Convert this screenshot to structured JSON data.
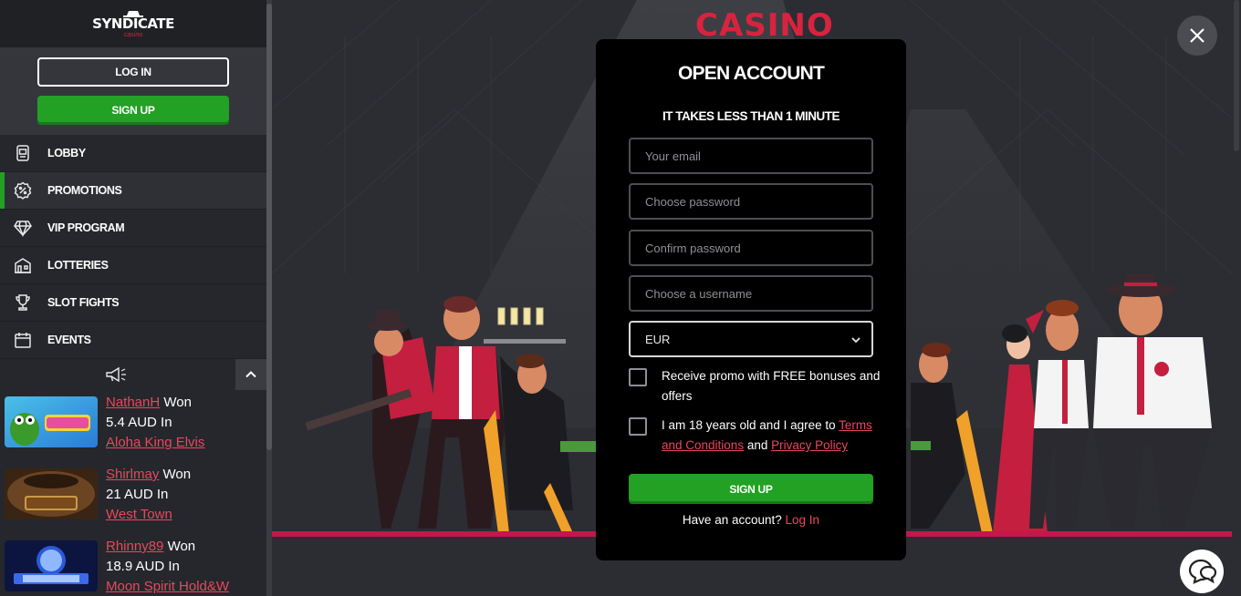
{
  "brand": {
    "logo_main": "SYNDICATE",
    "logo_sub": "casino",
    "casino_banner": "CASINO"
  },
  "sidebar": {
    "login_label": "LOG IN",
    "signup_label": "SIGN UP",
    "items": [
      {
        "label": "LOBBY",
        "icon": "slot-machine-icon"
      },
      {
        "label": "PROMOTIONS",
        "icon": "percent-badge-icon"
      },
      {
        "label": "VIP PROGRAM",
        "icon": "diamond-icon"
      },
      {
        "label": "LOTTERIES",
        "icon": "building-icon"
      },
      {
        "label": "SLOT FIGHTS",
        "icon": "trophy-icon"
      },
      {
        "label": "EVENTS",
        "icon": "calendar-icon"
      }
    ],
    "winners": [
      {
        "player": "NathanH",
        "won_word": "Won",
        "amount": "5.4 AUD In",
        "game": "Aloha King Elvis"
      },
      {
        "player": "Shirlmay",
        "won_word": "Won",
        "amount": "21 AUD In",
        "game": "West Town"
      },
      {
        "player": "Rhinny89",
        "won_word": "Won",
        "amount": "18.9 AUD In",
        "game": "Moon Spirit Hold&W"
      }
    ]
  },
  "modal": {
    "title": "OPEN ACCOUNT",
    "subtitle": "IT TAKES LESS THAN 1 MINUTE",
    "email_placeholder": "Your email",
    "password_placeholder": "Choose password",
    "confirm_placeholder": "Confirm password",
    "username_placeholder": "Choose a username",
    "currency_value": "EUR",
    "promo_text": "Receive promo with FREE bonuses and offers",
    "age_text_prefix": "I am 18 years old and I agree to",
    "terms_link": "Terms and Conditions",
    "and_word": "and",
    "privacy_link": "Privacy Policy",
    "signup_label": "SIGN UP",
    "have_account": "Have an account?",
    "login_link": "Log In"
  },
  "colors": {
    "accent_green": "#22a124",
    "accent_red": "#d8233f",
    "link_red": "#e8485d",
    "sidebar_bg": "#25272c",
    "main_bg": "#2b2d33"
  }
}
